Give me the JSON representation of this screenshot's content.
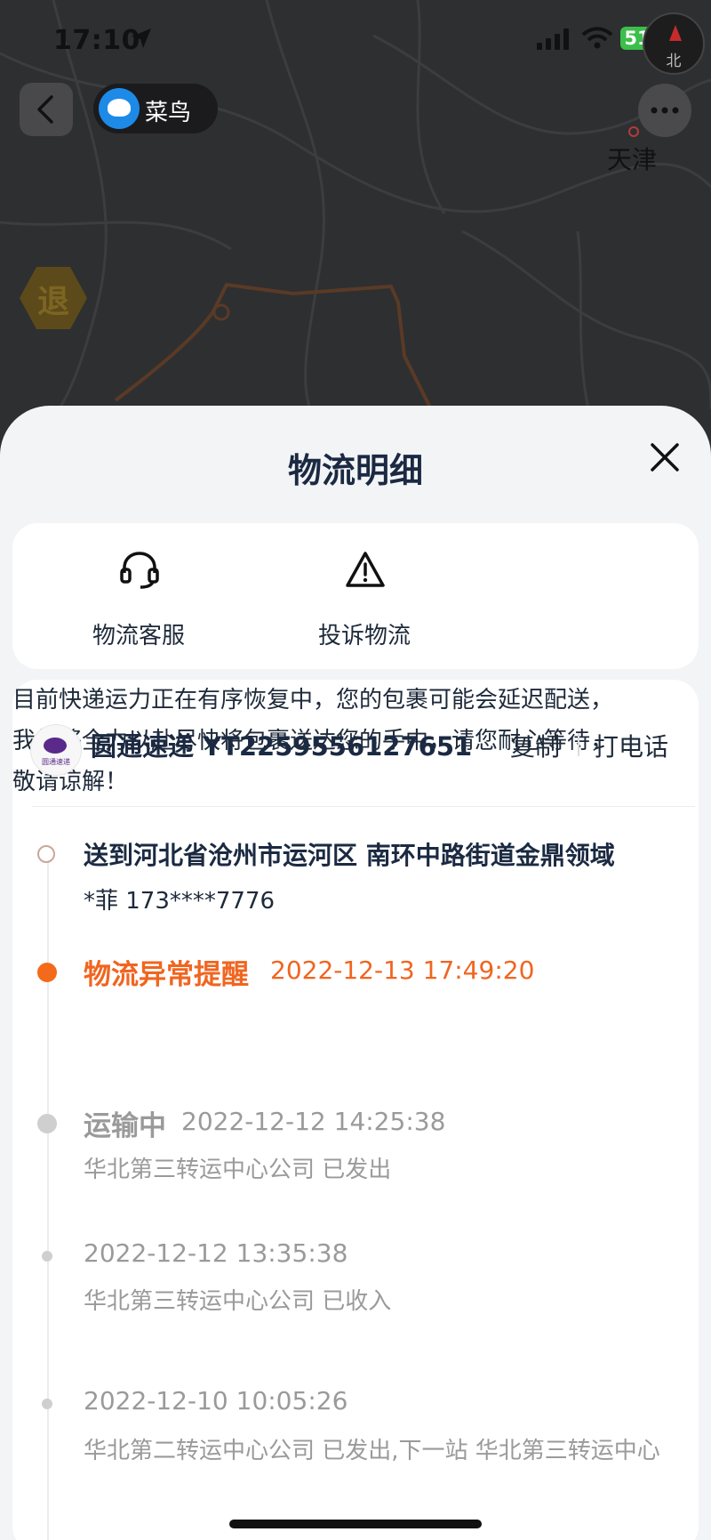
{
  "status_bar": {
    "time": "17:10",
    "battery": "51"
  },
  "compass": {
    "label": "北"
  },
  "header": {
    "brand_name": "菜鸟"
  },
  "map": {
    "city_label": "天津",
    "return_badge": "退"
  },
  "sheet": {
    "title": "物流明细"
  },
  "actions": [
    {
      "label": "物流客服",
      "icon": "headset-icon"
    },
    {
      "label": "投诉物流",
      "icon": "warning-icon"
    }
  ],
  "shipment": {
    "carrier_line": "圆通速递 YT2259556127651",
    "carrier_logo_caption": "圆通速递",
    "copy_label": "复制",
    "call_label": "打电话",
    "destination": "送到河北省沧州市运河区 南环中路街道金鼎领域",
    "recipient": "*菲 173****7776"
  },
  "events": [
    {
      "status": "物流异常提醒",
      "time": "2022-12-13 17:49:20",
      "desc": "目前快递运力正在有序恢复中，您的包裹可能会延迟配送，我们将全力以赴尽快将包裹送达您的手中，请您耐心等待，敬请谅解！"
    },
    {
      "status": "运输中",
      "time": "2022-12-12 14:25:38",
      "desc": "华北第三转运中心公司  已发出"
    },
    {
      "status": "",
      "time": "2022-12-12 13:35:38",
      "desc": "华北第三转运中心公司  已收入"
    },
    {
      "status": "",
      "time": "2022-12-10 10:05:26",
      "desc": "华北第二转运中心公司  已发出,下一站  华北第三转运中心"
    }
  ],
  "colors": {
    "accent": "#f06520",
    "title": "#1b2a42",
    "muted": "#9a9a9a"
  }
}
